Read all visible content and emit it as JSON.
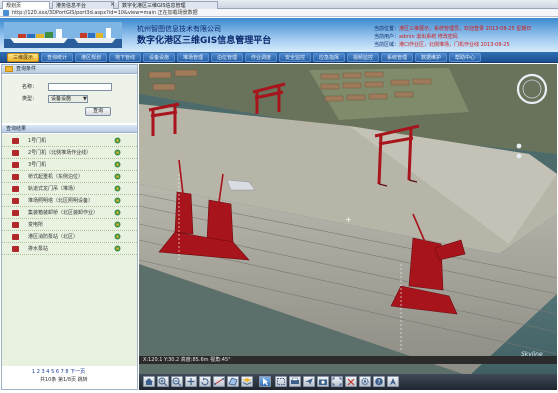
{
  "browser": {
    "tabs": [
      {
        "label": "规划页"
      },
      {
        "label": "港务信息平台"
      },
      {
        "label": "数字化港区三维GIS信息管理"
      }
    ],
    "close_label": "×",
    "address": "http://120.xxx/3DPortGIS/port3d.aspx?id=10&view=main  正在加载场景数据"
  },
  "header": {
    "company": "杭州智图信息技术有限公司",
    "system_title": "数字化港区三维GIS信息管理平台",
    "info": [
      {
        "label": "当前位置：",
        "value": "港区三维展示，系统管理员，欢迎登录  2013-08-25 星期日"
      },
      {
        "label": "当前用户：",
        "value": "admin  退出系统  修改密码"
      },
      {
        "label": "当前区域：",
        "value": "港口作业区，北侧堆场，门机作业线  2013-08-25"
      }
    ]
  },
  "menu": {
    "items": [
      {
        "label": "三维展示"
      },
      {
        "label": "查询统计"
      },
      {
        "label": "港区规划"
      },
      {
        "label": "地下管线"
      },
      {
        "label": "设备设施"
      },
      {
        "label": "堆场管理"
      },
      {
        "label": "泊位管理"
      },
      {
        "label": "作业调度"
      },
      {
        "label": "安全监控"
      },
      {
        "label": "应急指挥"
      },
      {
        "label": "视频监控"
      },
      {
        "label": "系统管理"
      },
      {
        "label": "数据维护"
      },
      {
        "label": "帮助中心"
      }
    ]
  },
  "panel": {
    "title": "查询条件",
    "name_label": "名称：",
    "name_value": "",
    "type_label": "类型：",
    "type_value": "设备设施",
    "query_button": "查询",
    "result_title": "查询结果",
    "results": [
      {
        "label": "1号门机"
      },
      {
        "label": "2号门机（北侧堆场作业线）"
      },
      {
        "label": "3号门机"
      },
      {
        "label": "桥式起重机（东侧泊位）"
      },
      {
        "label": "轨道式龙门吊（堆场）"
      },
      {
        "label": "堆场照明塔（北区照明设备）"
      },
      {
        "label": "集装箱装卸桥（北区装卸作业）"
      },
      {
        "label": "变电所"
      },
      {
        "label": "港区消防泵站（北区）"
      },
      {
        "label": "排水泵站"
      }
    ],
    "pager": "1 2 3 4 5 6 7 8 下一页",
    "pager_sub": "共10条 第1/8页 跳转"
  },
  "scene": {
    "status": "X:120.1 Y:30.2 高度:85.6m 视角:45°",
    "watermark": "Skyline"
  },
  "toolbar": {
    "icons": [
      "home-icon",
      "zoom-in-icon",
      "zoom-out-icon",
      "pan-icon",
      "rotate-icon",
      "measure-distance-icon",
      "measure-area-icon",
      "layer-icon",
      "cursor-icon",
      "select-icon",
      "print-icon",
      "fly-icon",
      "screenshot-icon",
      "fullscreen-icon",
      "clear-icon",
      "settings-icon",
      "help-icon",
      "north-icon"
    ]
  },
  "colors": {
    "menu_bar": "#1d4f8f",
    "menu_active": "#f0b731",
    "header_text": "#0b2a6e",
    "alert_text": "#d11a1a",
    "crane_red": "#a8141c",
    "result_bg": "#e9f2e1"
  }
}
